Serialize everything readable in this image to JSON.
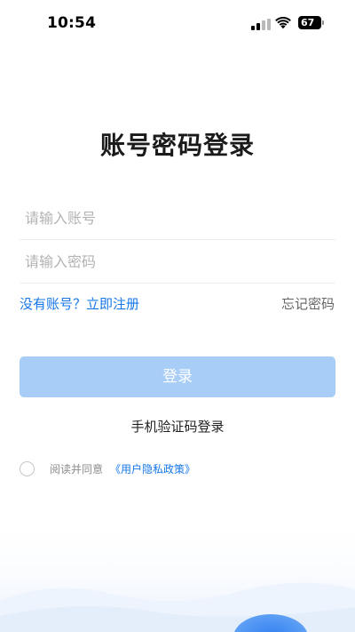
{
  "status_bar": {
    "time": "10:54",
    "battery": "67"
  },
  "title": "账号密码登录",
  "form": {
    "account_placeholder": "请输入账号",
    "password_placeholder": "请输入密码",
    "register_link": "没有账号？立即注册",
    "forgot_link": "忘记密码",
    "login_button": "登录",
    "sms_login": "手机验证码登录"
  },
  "agreement": {
    "text": "阅读并同意",
    "policy_link": "《用户隐私政策》"
  },
  "colors": {
    "accent": "#1677e8",
    "login_button_disabled": "#a8cdf7"
  }
}
